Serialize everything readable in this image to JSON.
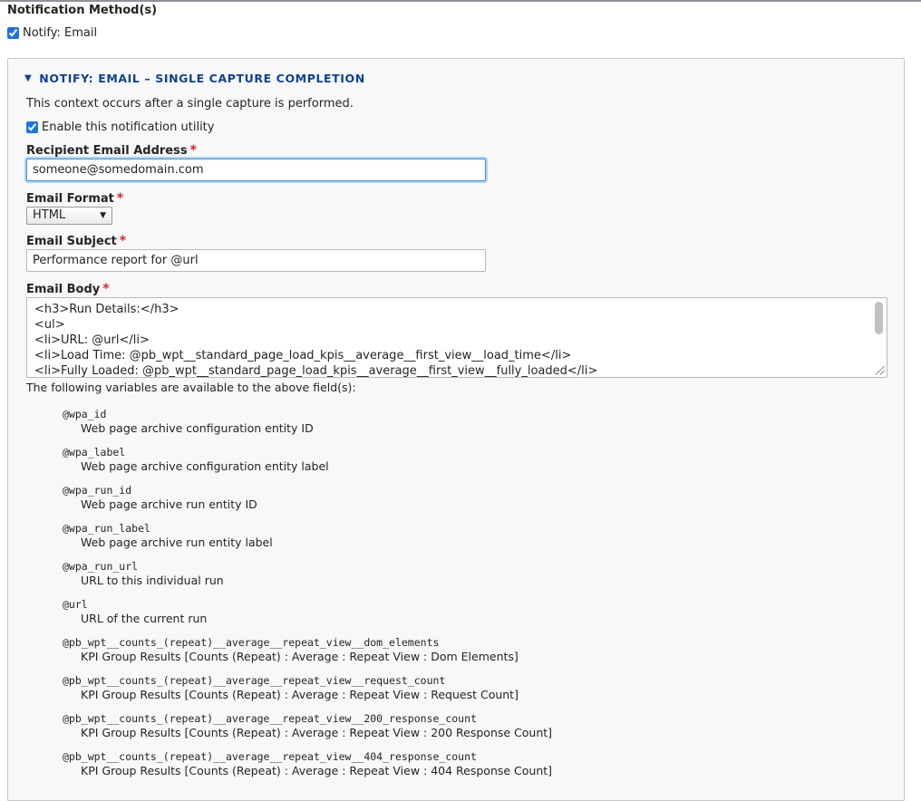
{
  "section": {
    "title": "Notification Method(s)",
    "notify_email_label": "Notify: Email",
    "notify_email_checked": true
  },
  "panel": {
    "summary_label": "Notify: Email – Single Capture Completion",
    "description": "This context occurs after a single capture is performed.",
    "enable_label": "Enable this notification utility",
    "enable_checked": true,
    "recipient_label": "Recipient Email Address",
    "recipient_value": "someone@somedomain.com",
    "format_label": "Email Format",
    "format_value": "HTML",
    "subject_label": "Email Subject",
    "subject_value": "Performance report for @url",
    "body_label": "Email Body",
    "body_lines": [
      "<h3>Run Details:</h3>",
      "<ul>",
      "<li>URL: @url</li>",
      "<li>Load Time: @pb_wpt__standard_page_load_kpis__average__first_view__load_time</li>",
      "<li>Fully Loaded: @pb_wpt__standard_page_load_kpis__average__first_view__fully_loaded</li>"
    ],
    "vars_intro": "The following variables are available to the above field(s):",
    "variables": [
      {
        "token": "@wpa_id",
        "desc": "Web page archive configuration entity ID"
      },
      {
        "token": "@wpa_label",
        "desc": "Web page archive configuration entity label"
      },
      {
        "token": "@wpa_run_id",
        "desc": "Web page archive run entity ID"
      },
      {
        "token": "@wpa_run_label",
        "desc": "Web page archive run entity label"
      },
      {
        "token": "@wpa_run_url",
        "desc": "URL to this individual run"
      },
      {
        "token": "@url",
        "desc": "URL of the current run"
      },
      {
        "token": "@pb_wpt__counts_(repeat)__average__repeat_view__dom_elements",
        "desc": "KPI Group Results [Counts (Repeat) : Average : Repeat View : Dom Elements]"
      },
      {
        "token": "@pb_wpt__counts_(repeat)__average__repeat_view__request_count",
        "desc": "KPI Group Results [Counts (Repeat) : Average : Repeat View : Request Count]"
      },
      {
        "token": "@pb_wpt__counts_(repeat)__average__repeat_view__200_response_count",
        "desc": "KPI Group Results [Counts (Repeat) : Average : Repeat View : 200 Response Count]"
      },
      {
        "token": "@pb_wpt__counts_(repeat)__average__repeat_view__404_response_count",
        "desc": "KPI Group Results [Counts (Repeat) : Average : Repeat View : 404 Response Count]"
      }
    ]
  }
}
